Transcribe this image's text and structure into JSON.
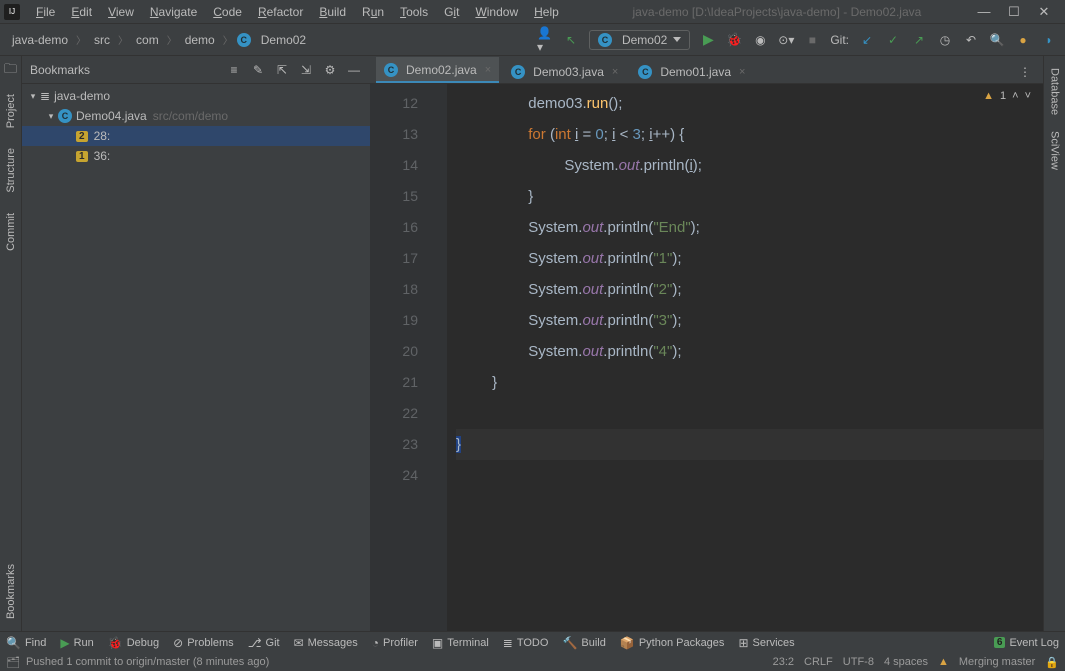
{
  "window": {
    "title": "java-demo [D:\\IdeaProjects\\java-demo] - Demo02.java"
  },
  "menu": {
    "file": "File",
    "edit": "Edit",
    "view": "View",
    "navigate": "Navigate",
    "code": "Code",
    "refactor": "Refactor",
    "build": "Build",
    "run": "Run",
    "tools": "Tools",
    "git": "Git",
    "window": "Window",
    "help": "Help"
  },
  "breadcrumb": {
    "p0": "java-demo",
    "p1": "src",
    "p2": "com",
    "p3": "demo",
    "p4": "Demo02"
  },
  "runconfig": {
    "name": "Demo02"
  },
  "nav": {
    "git_label": "Git:"
  },
  "bookmarks": {
    "title": "Bookmarks",
    "root": "java-demo",
    "file": "Demo04.java",
    "file_path": "src/com/demo",
    "items": [
      {
        "num": "2",
        "label": "28:"
      },
      {
        "num": "1",
        "label": "36:"
      }
    ]
  },
  "left_tabs": {
    "project": "Project",
    "structure": "Structure",
    "commit": "Commit",
    "bookmarks": "Bookmarks"
  },
  "right_tabs": {
    "database": "Database",
    "sciview": "SciView"
  },
  "tabs": [
    {
      "name": "Demo02.java",
      "active": true
    },
    {
      "name": "Demo03.java",
      "active": false
    },
    {
      "name": "Demo01.java",
      "active": false
    }
  ],
  "inspect": {
    "count": "1"
  },
  "lines": [
    "12",
    "13",
    "14",
    "15",
    "16",
    "17",
    "18",
    "19",
    "20",
    "21",
    "22",
    "23",
    "24"
  ],
  "code": {
    "l12_a": "demo03.",
    "l12_b": "run",
    "l12_c": "();",
    "l13_a": "for ",
    "l13_b": "(",
    "l13_c": "int ",
    "l13_d": "i",
    "l13_e": " = ",
    "l13_f": "0",
    "l13_g": "; ",
    "l13_h": "i",
    "l13_i": " < ",
    "l13_j": "3",
    "l13_k": "; ",
    "l13_l": "i",
    "l13_m": "++) {",
    "l14_a": "System.",
    "l14_b": "out",
    "l14_c": ".println(",
    "l14_d": "i",
    "l14_e": ");",
    "l15": "}",
    "l16_a": "System.",
    "l16_b": "out",
    "l16_c": ".println(",
    "l16_d": "\"End\"",
    "l16_e": ");",
    "l17_a": "System.",
    "l17_b": "out",
    "l17_c": ".println(",
    "l17_d": "\"1\"",
    "l17_e": ");",
    "l18_a": "System.",
    "l18_b": "out",
    "l18_c": ".println(",
    "l18_d": "\"2\"",
    "l18_e": ");",
    "l19_a": "System.",
    "l19_b": "out",
    "l19_c": ".println(",
    "l19_d": "\"3\"",
    "l19_e": ");",
    "l20_a": "System.",
    "l20_b": "out",
    "l20_c": ".println(",
    "l20_d": "\"4\"",
    "l20_e": ");",
    "l21": "}",
    "l23": "}"
  },
  "bottom": {
    "find": "Find",
    "run": "Run",
    "debug": "Debug",
    "problems": "Problems",
    "git": "Git",
    "messages": "Messages",
    "profiler": "Profiler",
    "terminal": "Terminal",
    "todo": "TODO",
    "build": "Build",
    "python": "Python Packages",
    "services": "Services",
    "eventlog": "Event Log"
  },
  "status": {
    "vcs": "Pushed 1 commit to origin/master (8 minutes ago)",
    "pos": "23:2",
    "eol": "CRLF",
    "enc": "UTF-8",
    "indent": "4 spaces",
    "branch": "Merging master"
  }
}
